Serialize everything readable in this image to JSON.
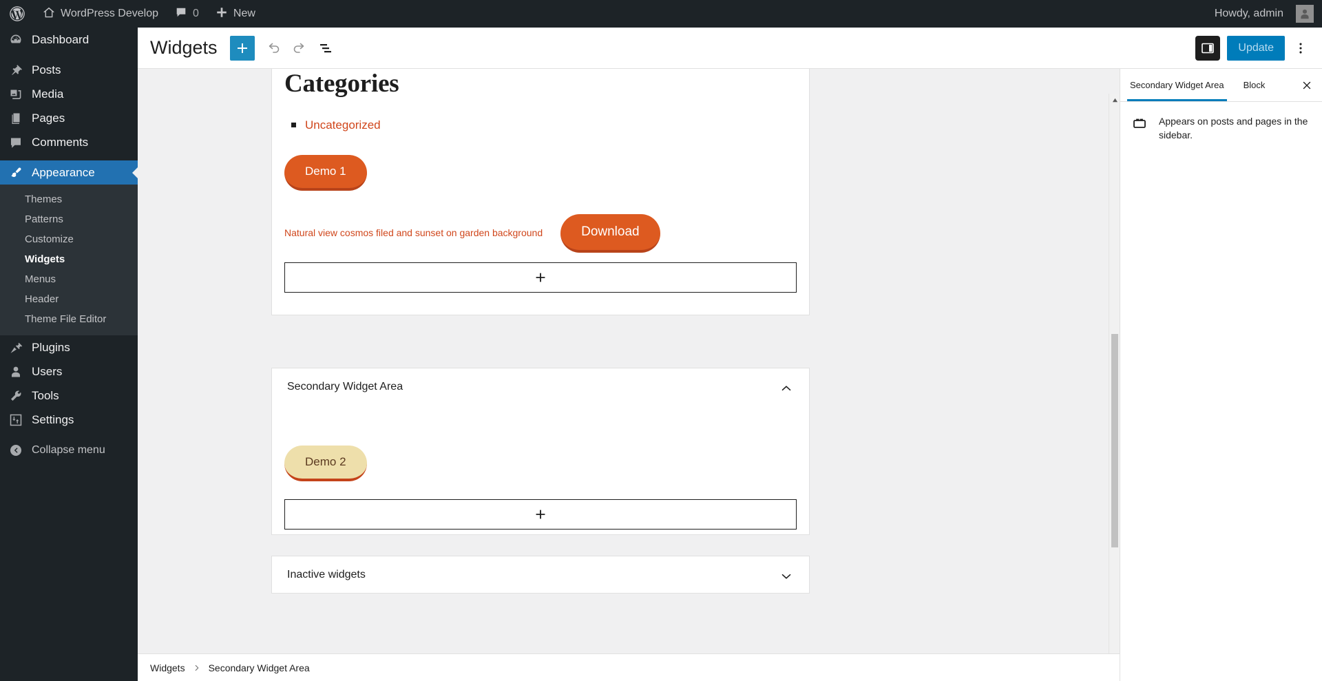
{
  "adminbar": {
    "logo_icon": "wordpress-logo-icon",
    "site_name": "WordPress Develop",
    "site_icon": "home-icon",
    "comments_icon": "comment-bubble-icon",
    "comments_count": "0",
    "new_icon": "plus-icon",
    "new_label": "New",
    "howdy": "Howdy, admin",
    "avatar_icon": "avatar-icon"
  },
  "sidebar": {
    "items": [
      {
        "label": "Dashboard",
        "icon": "dashboard-icon",
        "current": false
      },
      {
        "label": "Posts",
        "icon": "pin-icon",
        "current": false
      },
      {
        "label": "Media",
        "icon": "media-icon",
        "current": false
      },
      {
        "label": "Pages",
        "icon": "pages-icon",
        "current": false
      },
      {
        "label": "Comments",
        "icon": "comment-bubble-icon",
        "current": false
      },
      {
        "label": "Appearance",
        "icon": "paintbrush-icon",
        "current": true
      },
      {
        "label": "Plugins",
        "icon": "plug-icon",
        "current": false
      },
      {
        "label": "Users",
        "icon": "user-icon",
        "current": false
      },
      {
        "label": "Tools",
        "icon": "wrench-icon",
        "current": false
      },
      {
        "label": "Settings",
        "icon": "sliders-icon",
        "current": false
      }
    ],
    "submenu": [
      {
        "label": "Themes",
        "current": false
      },
      {
        "label": "Patterns",
        "current": false
      },
      {
        "label": "Customize",
        "current": false
      },
      {
        "label": "Widgets",
        "current": true
      },
      {
        "label": "Menus",
        "current": false
      },
      {
        "label": "Header",
        "current": false
      },
      {
        "label": "Theme File Editor",
        "current": false
      }
    ],
    "collapse": {
      "label": "Collapse menu",
      "icon": "collapse-arrow-icon"
    }
  },
  "header": {
    "title": "Widgets",
    "add_block_icon": "plus-icon",
    "undo_icon": "undo-arrow-icon",
    "redo_icon": "redo-arrow-icon",
    "list_view_icon": "list-view-icon",
    "sidebar_toggle_icon": "settings-sidebar-icon",
    "update_label": "Update",
    "options_icon": "kebab-vertical-icon"
  },
  "canvas": {
    "areas": [
      {
        "id": "primary",
        "title": "",
        "collapse_icon": "",
        "block": {
          "heading": "Categories",
          "categories": [
            "Uncategorized"
          ],
          "button": "Demo 1",
          "media_caption": "Natural view cosmos filed and sunset on garden background",
          "media_button": "Download"
        },
        "appender_icon": "plus-icon"
      },
      {
        "id": "secondary",
        "title": "Secondary Widget Area",
        "collapse_icon": "chevron-up-icon",
        "button": "Demo 2",
        "appender_icon": "plus-icon"
      },
      {
        "id": "inactive",
        "title": "Inactive widgets",
        "collapse_icon": "chevron-down-icon"
      }
    ]
  },
  "footer": {
    "breadcrumb": [
      "Widgets",
      "Secondary Widget Area"
    ],
    "separator_icon": "chevron-right-icon"
  },
  "settings_panel": {
    "tabs": [
      {
        "label": "Secondary Widget Area",
        "active": true
      },
      {
        "label": "Block",
        "active": false
      }
    ],
    "close_icon": "close-icon",
    "description_icon": "widget-area-icon",
    "description": "Appears on posts and pages in the sidebar."
  },
  "colors": {
    "admin_dark": "#1d2327",
    "admin_submenu": "#2c3338",
    "admin_blue": "#2271b1",
    "accent_blue": "#007cba",
    "add_block_blue": "#1e8cbe",
    "theme_orange": "#dd5a20",
    "theme_orange_dark": "#b8431a",
    "theme_link": "#d0461b",
    "demo2_bg": "#eedfab",
    "demo2_text": "#5b3a20",
    "body_bg": "#f0f0f1"
  },
  "scrollbar": {
    "up_icon": "triangle-up-icon",
    "down_icon": "triangle-down-icon"
  }
}
